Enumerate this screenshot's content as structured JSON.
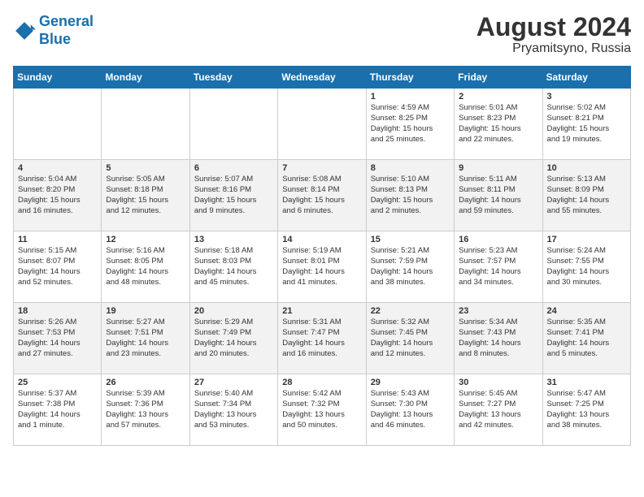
{
  "header": {
    "logo_text_1": "General",
    "logo_text_2": "Blue",
    "month": "August 2024",
    "location": "Pryamitsyno, Russia"
  },
  "days_of_week": [
    "Sunday",
    "Monday",
    "Tuesday",
    "Wednesday",
    "Thursday",
    "Friday",
    "Saturday"
  ],
  "weeks": [
    [
      {
        "day": "",
        "info": ""
      },
      {
        "day": "",
        "info": ""
      },
      {
        "day": "",
        "info": ""
      },
      {
        "day": "",
        "info": ""
      },
      {
        "day": "1",
        "info": "Sunrise: 4:59 AM\nSunset: 8:25 PM\nDaylight: 15 hours\nand 25 minutes."
      },
      {
        "day": "2",
        "info": "Sunrise: 5:01 AM\nSunset: 8:23 PM\nDaylight: 15 hours\nand 22 minutes."
      },
      {
        "day": "3",
        "info": "Sunrise: 5:02 AM\nSunset: 8:21 PM\nDaylight: 15 hours\nand 19 minutes."
      }
    ],
    [
      {
        "day": "4",
        "info": "Sunrise: 5:04 AM\nSunset: 8:20 PM\nDaylight: 15 hours\nand 16 minutes."
      },
      {
        "day": "5",
        "info": "Sunrise: 5:05 AM\nSunset: 8:18 PM\nDaylight: 15 hours\nand 12 minutes."
      },
      {
        "day": "6",
        "info": "Sunrise: 5:07 AM\nSunset: 8:16 PM\nDaylight: 15 hours\nand 9 minutes."
      },
      {
        "day": "7",
        "info": "Sunrise: 5:08 AM\nSunset: 8:14 PM\nDaylight: 15 hours\nand 6 minutes."
      },
      {
        "day": "8",
        "info": "Sunrise: 5:10 AM\nSunset: 8:13 PM\nDaylight: 15 hours\nand 2 minutes."
      },
      {
        "day": "9",
        "info": "Sunrise: 5:11 AM\nSunset: 8:11 PM\nDaylight: 14 hours\nand 59 minutes."
      },
      {
        "day": "10",
        "info": "Sunrise: 5:13 AM\nSunset: 8:09 PM\nDaylight: 14 hours\nand 55 minutes."
      }
    ],
    [
      {
        "day": "11",
        "info": "Sunrise: 5:15 AM\nSunset: 8:07 PM\nDaylight: 14 hours\nand 52 minutes."
      },
      {
        "day": "12",
        "info": "Sunrise: 5:16 AM\nSunset: 8:05 PM\nDaylight: 14 hours\nand 48 minutes."
      },
      {
        "day": "13",
        "info": "Sunrise: 5:18 AM\nSunset: 8:03 PM\nDaylight: 14 hours\nand 45 minutes."
      },
      {
        "day": "14",
        "info": "Sunrise: 5:19 AM\nSunset: 8:01 PM\nDaylight: 14 hours\nand 41 minutes."
      },
      {
        "day": "15",
        "info": "Sunrise: 5:21 AM\nSunset: 7:59 PM\nDaylight: 14 hours\nand 38 minutes."
      },
      {
        "day": "16",
        "info": "Sunrise: 5:23 AM\nSunset: 7:57 PM\nDaylight: 14 hours\nand 34 minutes."
      },
      {
        "day": "17",
        "info": "Sunrise: 5:24 AM\nSunset: 7:55 PM\nDaylight: 14 hours\nand 30 minutes."
      }
    ],
    [
      {
        "day": "18",
        "info": "Sunrise: 5:26 AM\nSunset: 7:53 PM\nDaylight: 14 hours\nand 27 minutes."
      },
      {
        "day": "19",
        "info": "Sunrise: 5:27 AM\nSunset: 7:51 PM\nDaylight: 14 hours\nand 23 minutes."
      },
      {
        "day": "20",
        "info": "Sunrise: 5:29 AM\nSunset: 7:49 PM\nDaylight: 14 hours\nand 20 minutes."
      },
      {
        "day": "21",
        "info": "Sunrise: 5:31 AM\nSunset: 7:47 PM\nDaylight: 14 hours\nand 16 minutes."
      },
      {
        "day": "22",
        "info": "Sunrise: 5:32 AM\nSunset: 7:45 PM\nDaylight: 14 hours\nand 12 minutes."
      },
      {
        "day": "23",
        "info": "Sunrise: 5:34 AM\nSunset: 7:43 PM\nDaylight: 14 hours\nand 8 minutes."
      },
      {
        "day": "24",
        "info": "Sunrise: 5:35 AM\nSunset: 7:41 PM\nDaylight: 14 hours\nand 5 minutes."
      }
    ],
    [
      {
        "day": "25",
        "info": "Sunrise: 5:37 AM\nSunset: 7:38 PM\nDaylight: 14 hours\nand 1 minute."
      },
      {
        "day": "26",
        "info": "Sunrise: 5:39 AM\nSunset: 7:36 PM\nDaylight: 13 hours\nand 57 minutes."
      },
      {
        "day": "27",
        "info": "Sunrise: 5:40 AM\nSunset: 7:34 PM\nDaylight: 13 hours\nand 53 minutes."
      },
      {
        "day": "28",
        "info": "Sunrise: 5:42 AM\nSunset: 7:32 PM\nDaylight: 13 hours\nand 50 minutes."
      },
      {
        "day": "29",
        "info": "Sunrise: 5:43 AM\nSunset: 7:30 PM\nDaylight: 13 hours\nand 46 minutes."
      },
      {
        "day": "30",
        "info": "Sunrise: 5:45 AM\nSunset: 7:27 PM\nDaylight: 13 hours\nand 42 minutes."
      },
      {
        "day": "31",
        "info": "Sunrise: 5:47 AM\nSunset: 7:25 PM\nDaylight: 13 hours\nand 38 minutes."
      }
    ]
  ]
}
